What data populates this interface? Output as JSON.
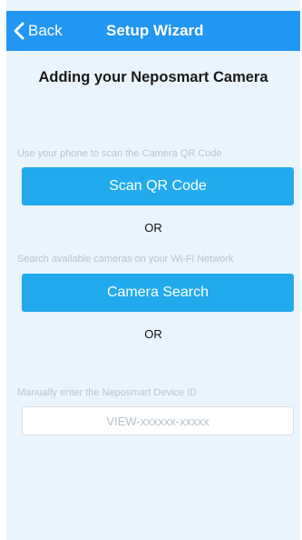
{
  "navbar": {
    "back_label": "Back",
    "title": "Setup Wizard"
  },
  "heading": "Adding your Neposmart Camera",
  "qr": {
    "hint": "Use your phone to scan the Camera QR Code",
    "button_label": "Scan QR Code"
  },
  "or_label": "OR",
  "search": {
    "hint": "Search available cameras on your Wi-Fi Network",
    "button_label": "Camera Search"
  },
  "manual": {
    "hint": "Manually enter the Neposmart Device ID",
    "placeholder": "VIEW-xxxxxx-xxxxx",
    "value": ""
  },
  "colors": {
    "navbar": "#2196f3",
    "button": "#22aaee",
    "background": "#eaf4fc"
  },
  "icons": {
    "back": "chevron-left-icon"
  }
}
